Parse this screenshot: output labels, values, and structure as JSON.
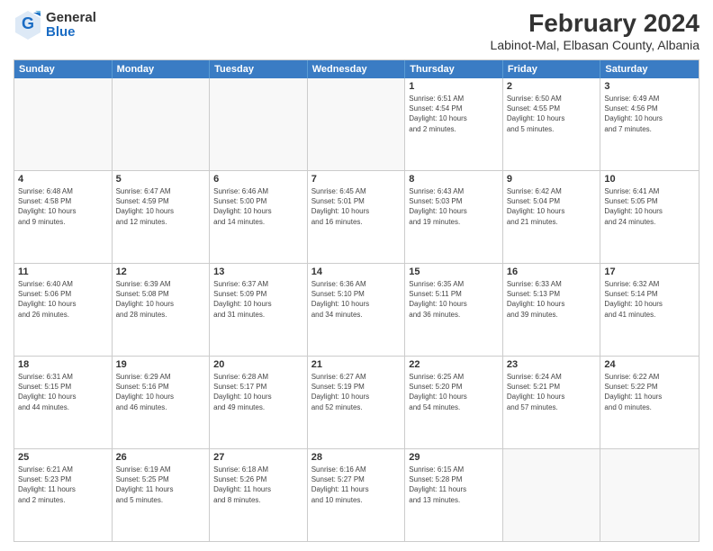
{
  "logo": {
    "general": "General",
    "blue": "Blue"
  },
  "title": "February 2024",
  "subtitle": "Labinot-Mal, Elbasan County, Albania",
  "days": [
    "Sunday",
    "Monday",
    "Tuesday",
    "Wednesday",
    "Thursday",
    "Friday",
    "Saturday"
  ],
  "rows": [
    [
      {
        "day": "",
        "lines": []
      },
      {
        "day": "",
        "lines": []
      },
      {
        "day": "",
        "lines": []
      },
      {
        "day": "",
        "lines": []
      },
      {
        "day": "1",
        "lines": [
          "Sunrise: 6:51 AM",
          "Sunset: 4:54 PM",
          "Daylight: 10 hours",
          "and 2 minutes."
        ]
      },
      {
        "day": "2",
        "lines": [
          "Sunrise: 6:50 AM",
          "Sunset: 4:55 PM",
          "Daylight: 10 hours",
          "and 5 minutes."
        ]
      },
      {
        "day": "3",
        "lines": [
          "Sunrise: 6:49 AM",
          "Sunset: 4:56 PM",
          "Daylight: 10 hours",
          "and 7 minutes."
        ]
      }
    ],
    [
      {
        "day": "4",
        "lines": [
          "Sunrise: 6:48 AM",
          "Sunset: 4:58 PM",
          "Daylight: 10 hours",
          "and 9 minutes."
        ]
      },
      {
        "day": "5",
        "lines": [
          "Sunrise: 6:47 AM",
          "Sunset: 4:59 PM",
          "Daylight: 10 hours",
          "and 12 minutes."
        ]
      },
      {
        "day": "6",
        "lines": [
          "Sunrise: 6:46 AM",
          "Sunset: 5:00 PM",
          "Daylight: 10 hours",
          "and 14 minutes."
        ]
      },
      {
        "day": "7",
        "lines": [
          "Sunrise: 6:45 AM",
          "Sunset: 5:01 PM",
          "Daylight: 10 hours",
          "and 16 minutes."
        ]
      },
      {
        "day": "8",
        "lines": [
          "Sunrise: 6:43 AM",
          "Sunset: 5:03 PM",
          "Daylight: 10 hours",
          "and 19 minutes."
        ]
      },
      {
        "day": "9",
        "lines": [
          "Sunrise: 6:42 AM",
          "Sunset: 5:04 PM",
          "Daylight: 10 hours",
          "and 21 minutes."
        ]
      },
      {
        "day": "10",
        "lines": [
          "Sunrise: 6:41 AM",
          "Sunset: 5:05 PM",
          "Daylight: 10 hours",
          "and 24 minutes."
        ]
      }
    ],
    [
      {
        "day": "11",
        "lines": [
          "Sunrise: 6:40 AM",
          "Sunset: 5:06 PM",
          "Daylight: 10 hours",
          "and 26 minutes."
        ]
      },
      {
        "day": "12",
        "lines": [
          "Sunrise: 6:39 AM",
          "Sunset: 5:08 PM",
          "Daylight: 10 hours",
          "and 28 minutes."
        ]
      },
      {
        "day": "13",
        "lines": [
          "Sunrise: 6:37 AM",
          "Sunset: 5:09 PM",
          "Daylight: 10 hours",
          "and 31 minutes."
        ]
      },
      {
        "day": "14",
        "lines": [
          "Sunrise: 6:36 AM",
          "Sunset: 5:10 PM",
          "Daylight: 10 hours",
          "and 34 minutes."
        ]
      },
      {
        "day": "15",
        "lines": [
          "Sunrise: 6:35 AM",
          "Sunset: 5:11 PM",
          "Daylight: 10 hours",
          "and 36 minutes."
        ]
      },
      {
        "day": "16",
        "lines": [
          "Sunrise: 6:33 AM",
          "Sunset: 5:13 PM",
          "Daylight: 10 hours",
          "and 39 minutes."
        ]
      },
      {
        "day": "17",
        "lines": [
          "Sunrise: 6:32 AM",
          "Sunset: 5:14 PM",
          "Daylight: 10 hours",
          "and 41 minutes."
        ]
      }
    ],
    [
      {
        "day": "18",
        "lines": [
          "Sunrise: 6:31 AM",
          "Sunset: 5:15 PM",
          "Daylight: 10 hours",
          "and 44 minutes."
        ]
      },
      {
        "day": "19",
        "lines": [
          "Sunrise: 6:29 AM",
          "Sunset: 5:16 PM",
          "Daylight: 10 hours",
          "and 46 minutes."
        ]
      },
      {
        "day": "20",
        "lines": [
          "Sunrise: 6:28 AM",
          "Sunset: 5:17 PM",
          "Daylight: 10 hours",
          "and 49 minutes."
        ]
      },
      {
        "day": "21",
        "lines": [
          "Sunrise: 6:27 AM",
          "Sunset: 5:19 PM",
          "Daylight: 10 hours",
          "and 52 minutes."
        ]
      },
      {
        "day": "22",
        "lines": [
          "Sunrise: 6:25 AM",
          "Sunset: 5:20 PM",
          "Daylight: 10 hours",
          "and 54 minutes."
        ]
      },
      {
        "day": "23",
        "lines": [
          "Sunrise: 6:24 AM",
          "Sunset: 5:21 PM",
          "Daylight: 10 hours",
          "and 57 minutes."
        ]
      },
      {
        "day": "24",
        "lines": [
          "Sunrise: 6:22 AM",
          "Sunset: 5:22 PM",
          "Daylight: 11 hours",
          "and 0 minutes."
        ]
      }
    ],
    [
      {
        "day": "25",
        "lines": [
          "Sunrise: 6:21 AM",
          "Sunset: 5:23 PM",
          "Daylight: 11 hours",
          "and 2 minutes."
        ]
      },
      {
        "day": "26",
        "lines": [
          "Sunrise: 6:19 AM",
          "Sunset: 5:25 PM",
          "Daylight: 11 hours",
          "and 5 minutes."
        ]
      },
      {
        "day": "27",
        "lines": [
          "Sunrise: 6:18 AM",
          "Sunset: 5:26 PM",
          "Daylight: 11 hours",
          "and 8 minutes."
        ]
      },
      {
        "day": "28",
        "lines": [
          "Sunrise: 6:16 AM",
          "Sunset: 5:27 PM",
          "Daylight: 11 hours",
          "and 10 minutes."
        ]
      },
      {
        "day": "29",
        "lines": [
          "Sunrise: 6:15 AM",
          "Sunset: 5:28 PM",
          "Daylight: 11 hours",
          "and 13 minutes."
        ]
      },
      {
        "day": "",
        "lines": []
      },
      {
        "day": "",
        "lines": []
      }
    ]
  ]
}
